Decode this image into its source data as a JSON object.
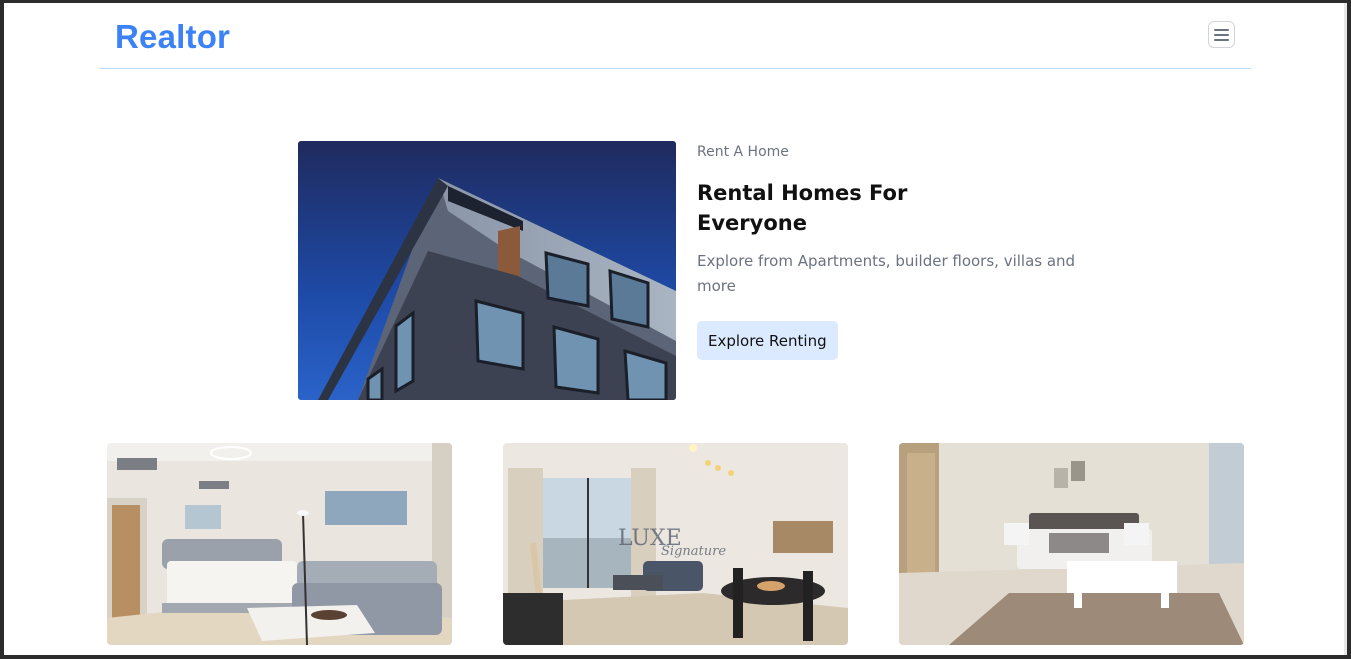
{
  "brand": {
    "name": "Realtor"
  },
  "icons": {
    "menu": "hamburger-menu-icon"
  },
  "hero": {
    "eyebrow": "Rent A Home",
    "title": "Rental Homes For Everyone",
    "description": "Explore from Apartments, builder floors, villas and more",
    "cta_label": "Explore Renting",
    "image": "modern-building-photo"
  },
  "gallery": [
    {
      "image": "bedroom-living-room-photo"
    },
    {
      "image": "living-dining-room-photo",
      "watermark": "LUXE",
      "watermark_sub": "Signature"
    },
    {
      "image": "bedroom-photo"
    }
  ],
  "colors": {
    "brand": "#3b82f6",
    "cta_background": "#dbeafe",
    "divider": "#bfdbfe"
  }
}
